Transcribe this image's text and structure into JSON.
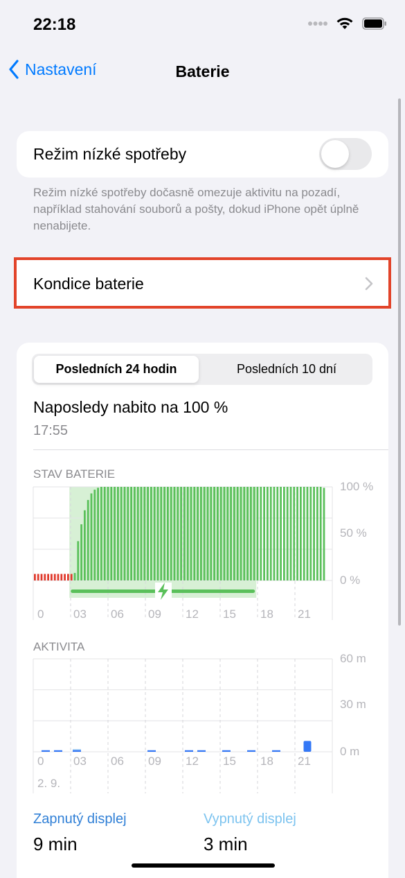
{
  "status": {
    "time": "22:18"
  },
  "nav": {
    "back_label": "Nastavení",
    "title": "Baterie"
  },
  "low_power": {
    "label": "Režim nízké spotřeby",
    "enabled": false,
    "footnote": "Režim nízké spotřeby dočasně omezuje aktivitu na pozadí, například stahování souborů a pošty, dokud iPhone opět úplně nenabijete."
  },
  "battery_health": {
    "label": "Kondice baterie"
  },
  "segmented": {
    "tabs": [
      "Posledních 24 hodin",
      "Posledních 10 dní"
    ],
    "selected": 0
  },
  "last_charged": {
    "text": "Naposledy nabito na 100 %",
    "time": "17:55"
  },
  "battery_section": {
    "title": "STAV BATERIE"
  },
  "activity_section": {
    "title": "AKTIVITA",
    "date": "2. 9."
  },
  "legend": {
    "screen_on_label": "Zapnutý displej",
    "screen_on_value": "9 min",
    "screen_off_label": "Vypnutý displej",
    "screen_off_value": "3 min"
  },
  "colors": {
    "accent": "#007aff",
    "battery_green": "#5ac05a",
    "battery_low": "#e0392c",
    "charge_band": "#d7f0d5",
    "activity_bar": "#3478f6",
    "activity_light": "#9ccaf2",
    "highlight_box": "#e2442a"
  },
  "chart_data": [
    {
      "type": "bar",
      "title": "STAV BATERIE",
      "x_ticks": [
        "0",
        "03",
        "06",
        "09",
        "12",
        "15",
        "18",
        "21"
      ],
      "y_ticks": [
        "100 %",
        "50 %",
        "0 %"
      ],
      "ylim": [
        0,
        100
      ],
      "x_range_hours": [
        0,
        24
      ],
      "charging_period_hours": [
        2.9,
        17.9
      ],
      "series": [
        {
          "values": [
            7,
            7,
            7,
            7,
            7,
            7,
            7,
            7,
            7,
            7,
            7,
            7,
            8,
            42,
            60,
            75,
            86,
            93,
            97,
            99,
            100,
            100,
            100,
            100,
            100,
            100,
            100,
            100,
            100,
            100,
            100,
            100,
            100,
            100,
            100,
            100,
            100,
            100,
            100,
            100,
            100,
            100,
            100,
            100,
            100,
            100,
            100,
            100,
            100,
            100,
            100,
            100,
            100,
            100,
            100,
            100,
            100,
            100,
            100,
            100,
            100,
            100,
            100,
            100,
            100,
            100,
            100,
            100,
            100,
            100,
            100,
            100,
            100,
            100,
            100,
            100,
            100,
            100,
            100,
            100,
            100,
            100,
            100,
            100,
            100,
            100,
            100,
            99
          ]
        }
      ]
    },
    {
      "type": "bar",
      "title": "AKTIVITA",
      "x_ticks": [
        "0",
        "03",
        "06",
        "09",
        "12",
        "15",
        "18",
        "21"
      ],
      "y_ticks": [
        "60 m",
        "30 m",
        "0 m"
      ],
      "ylim": [
        0,
        60
      ],
      "x_range_hours": [
        0,
        24
      ],
      "series": [
        {
          "name": "Zapnutý displej",
          "x_hours": [
            1.0,
            2.0,
            3.5,
            9.5,
            12.5,
            13.5,
            15.5,
            17.5,
            19.5,
            22.0
          ],
          "values": [
            1,
            1,
            1,
            1,
            1,
            1,
            1,
            1,
            1,
            7
          ]
        },
        {
          "name": "Vypnutý displej",
          "x_hours": [
            3.5
          ],
          "values": [
            1
          ]
        }
      ]
    }
  ]
}
